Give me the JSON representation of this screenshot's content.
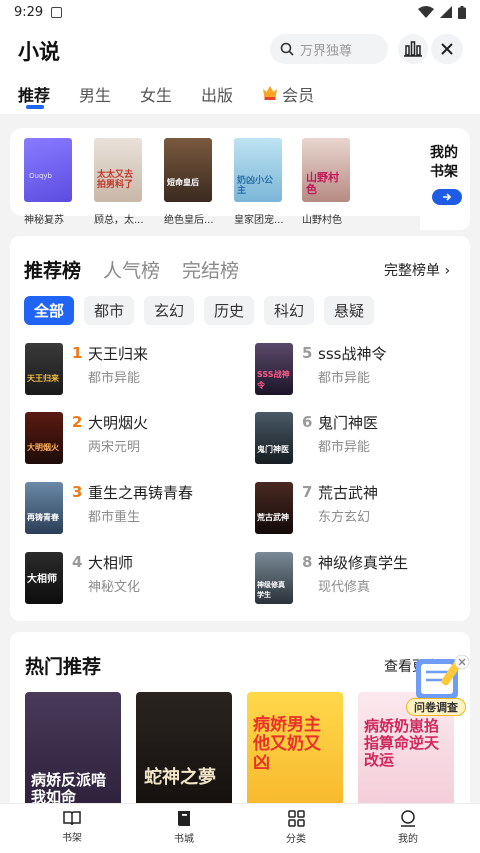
{
  "status": {
    "time": "9:29"
  },
  "header": {
    "title": "小说",
    "search_placeholder": "万界独尊"
  },
  "tabs": [
    {
      "label": "推荐",
      "active": true
    },
    {
      "label": "男生"
    },
    {
      "label": "女生"
    },
    {
      "label": "出版"
    },
    {
      "label": "会员"
    }
  ],
  "shelf": {
    "books": [
      {
        "label": "神秘复苏",
        "cover_text": "Ouqyb"
      },
      {
        "label": "顾总，太...",
        "cover_text": "太太又去拍男科了"
      },
      {
        "label": "绝色皇后...",
        "cover_text": "短命皇后"
      },
      {
        "label": "皇家团宠...",
        "cover_text": "奶凶小公主"
      },
      {
        "label": "山野村色",
        "cover_text": "山野村色"
      }
    ],
    "entry_label": "我的书架"
  },
  "ranking": {
    "tabs": [
      "推荐榜",
      "人气榜",
      "完结榜"
    ],
    "full_list_label": "完整榜单",
    "chips": [
      "全部",
      "都市",
      "玄幻",
      "历史",
      "科幻",
      "悬疑"
    ],
    "items": [
      {
        "rank": "1",
        "name": "天王归来",
        "category": "都市异能",
        "cover_text": "天王归来"
      },
      {
        "rank": "2",
        "name": "大明烟火",
        "category": "两宋元明",
        "cover_text": "大明烟火"
      },
      {
        "rank": "3",
        "name": "重生之再铸青春",
        "category": "都市重生",
        "cover_text": "再铸青春"
      },
      {
        "rank": "4",
        "name": "大相师",
        "category": "神秘文化",
        "cover_text": "大相师"
      },
      {
        "rank": "5",
        "name": "sss战神令",
        "category": "都市异能",
        "cover_text": "SSS战神令"
      },
      {
        "rank": "6",
        "name": "鬼门神医",
        "category": "都市异能",
        "cover_text": "鬼门神医"
      },
      {
        "rank": "7",
        "name": "荒古武神",
        "category": "东方玄幻",
        "cover_text": "荒古武神"
      },
      {
        "rank": "8",
        "name": "神级修真学生",
        "category": "现代修真",
        "cover_text": "神级修真学生"
      }
    ],
    "rank_colors": {
      "1": "#f07a1a",
      "2": "#f07a1a",
      "3": "#f07a1a",
      "4": "#9a9a9a",
      "5": "#9a9a9a",
      "6": "#9a9a9a",
      "7": "#9a9a9a",
      "8": "#9a9a9a"
    }
  },
  "hot": {
    "title": "热门推荐",
    "more_label": "查看更多",
    "books": [
      {
        "cover_text": "病娇反派喑我如命"
      },
      {
        "cover_text": "蛇神之夢"
      },
      {
        "cover_text": "病娇男主他又奶又凶"
      },
      {
        "cover_text": "病娇奶崽掐指算命逆天改运"
      }
    ],
    "survey_label": "问卷调查"
  },
  "bottom_nav": [
    {
      "label": "书架",
      "icon": "book-open-icon"
    },
    {
      "label": "书城",
      "icon": "bookstore-icon",
      "active": true
    },
    {
      "label": "分类",
      "icon": "grid-icon"
    },
    {
      "label": "我的",
      "icon": "profile-icon"
    }
  ],
  "colors": {
    "accent": "#1f64f2",
    "rank_top": "#f07a1a",
    "rank_rest": "#9a9a9a"
  }
}
